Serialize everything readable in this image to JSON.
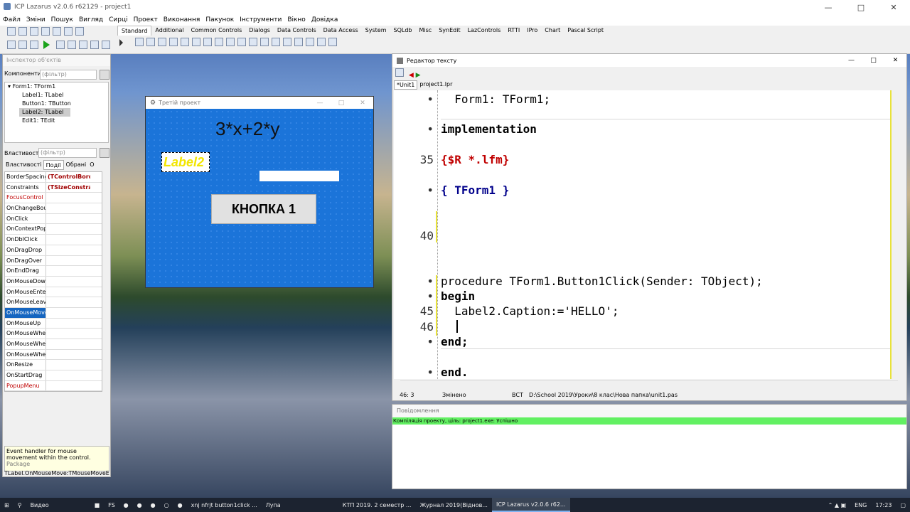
{
  "window": {
    "title": "ICP Lazarus v2.0.6 r62129 - project1"
  },
  "menu": [
    "Файл",
    "Зміни",
    "Пошук",
    "Вигляд",
    "Сирці",
    "Проект",
    "Виконання",
    "Пакунок",
    "Інструменти",
    "Вікно",
    "Довідка"
  ],
  "palette_tabs": [
    "Standard",
    "Additional",
    "Common Controls",
    "Dialogs",
    "Data Controls",
    "Data Access",
    "System",
    "SQLdb",
    "Misc",
    "SynEdit",
    "LazControls",
    "RTTI",
    "IPro",
    "Chart",
    "Pascal Script"
  ],
  "inspector": {
    "title": "Інспектор об'єктів",
    "components_label": "Компоненти",
    "filter_placeholder": "(фільтр)",
    "tree": [
      "Form1: TForm1",
      "Label1: TLabel",
      "Button1: TButton",
      "Label2: TLabel",
      "Edit1: TEdit"
    ],
    "properties_label": "Властивості",
    "tabs": [
      "Властивості",
      "Події",
      "Обрані",
      "О"
    ],
    "props": [
      {
        "name": "BorderSpacing",
        "value": "(TControlBorder"
      },
      {
        "name": "Constraints",
        "value": "(TSizeConstraint"
      },
      {
        "name": "FocusControl",
        "value": ""
      },
      {
        "name": "OnChangeBoun",
        "value": ""
      },
      {
        "name": "OnClick",
        "value": ""
      },
      {
        "name": "OnContextPopu",
        "value": ""
      },
      {
        "name": "OnDblClick",
        "value": ""
      },
      {
        "name": "OnDragDrop",
        "value": ""
      },
      {
        "name": "OnDragOver",
        "value": ""
      },
      {
        "name": "OnEndDrag",
        "value": ""
      },
      {
        "name": "OnMouseDown",
        "value": ""
      },
      {
        "name": "OnMouseEnter",
        "value": ""
      },
      {
        "name": "OnMouseLeave",
        "value": ""
      },
      {
        "name": "OnMouseMove",
        "value": ""
      },
      {
        "name": "OnMouseUp",
        "value": ""
      },
      {
        "name": "OnMouseWheel",
        "value": ""
      },
      {
        "name": "OnMouseWheel",
        "value": ""
      },
      {
        "name": "OnMouseWheel",
        "value": ""
      },
      {
        "name": "OnResize",
        "value": ""
      },
      {
        "name": "OnStartDrag",
        "value": ""
      },
      {
        "name": "PopupMenu",
        "value": ""
      }
    ],
    "hint": "Event handler for mouse movement within the control.",
    "hint_cut": "Package",
    "status": "TLabel.OnMouseMove:TMouseMoveEve"
  },
  "form": {
    "title": "Третій проект",
    "heading": "3*x+2*y",
    "label2": "Label2",
    "button": "КНОПКА 1"
  },
  "editor": {
    "title": "Редактор тексту",
    "tabs": [
      "*Unit1",
      "project1.lpr"
    ],
    "lines": [
      {
        "num": "•",
        "text": "  Form1: TForm1;"
      },
      {
        "num": "•",
        "text": "implementation"
      },
      {
        "num": "35",
        "text": "{$R *.lfm}"
      },
      {
        "num": "•",
        "text": "{ TForm1 }"
      },
      {
        "num": "40",
        "text": ""
      },
      {
        "num": "•",
        "text": "procedure TForm1.Button1Click(Sender: TObject);"
      },
      {
        "num": "•",
        "text": "begin"
      },
      {
        "num": "45",
        "text": "  Label2.Caption:='HELLO';"
      },
      {
        "num": "46",
        "text": ""
      },
      {
        "num": "•",
        "text": "end;"
      },
      {
        "num": "•",
        "text": "end."
      }
    ],
    "status": {
      "pos": "46:  3",
      "state": "Змінено",
      "mode": "ВСТ",
      "path": "D:\\School 2019\\Уроки\\8 клас\\Нова папка\\unit1.pas"
    }
  },
  "messages": {
    "title": "Повідомлення",
    "line": "Компіляція проекту, ціль: project1.exe: Успішно"
  },
  "taskbar": {
    "search": "Видео",
    "items": [
      "xnj nfrjt button1click ...",
      "Лупа",
      "КТП 2019. 2 семестр ...",
      "Журнал 2019(Віднов...",
      "ICP Lazarus v2.0.6 r62..."
    ],
    "lang": "ENG",
    "time": "17:23"
  }
}
